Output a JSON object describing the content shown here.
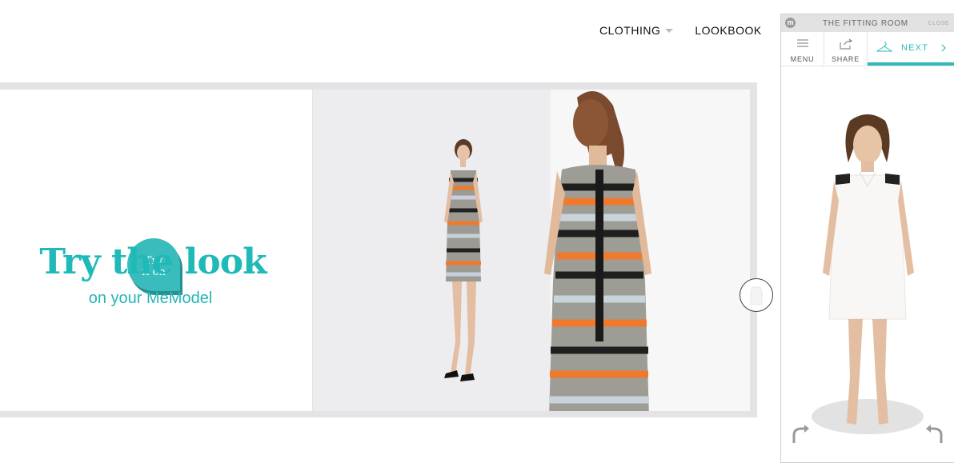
{
  "nav": {
    "clothing": "CLOTHING",
    "lookbook": "LOOKBOOK"
  },
  "hero": {
    "bubble_line1": "Try",
    "bubble_line2": "it on",
    "title": "Try the look",
    "subtitle": "on your MeModel",
    "accent": "#1fbab8"
  },
  "fitting_room": {
    "logo": "m",
    "title": "THE FITTING ROOM",
    "close": "CLOSE",
    "tabs": {
      "menu": "MENU",
      "share": "SHARE",
      "next": "NEXT"
    },
    "icons": [
      "menu-icon",
      "share-icon",
      "hanger-icon",
      "chevron-right-icon",
      "rotate-left-icon",
      "rotate-right-icon"
    ]
  },
  "colors": {
    "teal": "#2fb9b7",
    "hero_bg": "#e4e4e6"
  }
}
